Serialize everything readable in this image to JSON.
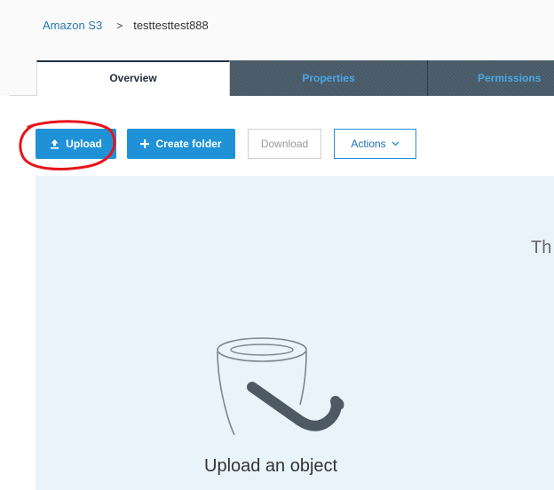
{
  "breadcrumb": {
    "root": "Amazon S3",
    "separator": ">",
    "current": "testtesttest888"
  },
  "tabs": [
    {
      "label": "Overview",
      "active": true
    },
    {
      "label": "Properties",
      "active": false
    },
    {
      "label": "Permissions",
      "active": false
    }
  ],
  "toolbar": {
    "upload_label": "Upload",
    "create_folder_label": "Create folder",
    "download_label": "Download",
    "actions_label": "Actions"
  },
  "dropzone": {
    "partial_text": "Th",
    "upload_object_label": "Upload an object"
  },
  "colors": {
    "primary_button": "#1f91d6",
    "tab_dark": "#485a67",
    "tab_dark_text": "#4aa8e4",
    "dropzone_bg": "#e9f3fa",
    "highlight_ring": "#e8141b"
  },
  "icons": {
    "upload": "upload-arrow-icon",
    "create_folder": "plus-icon",
    "actions": "chevron-down-icon",
    "bucket": "s3-bucket-icon"
  }
}
